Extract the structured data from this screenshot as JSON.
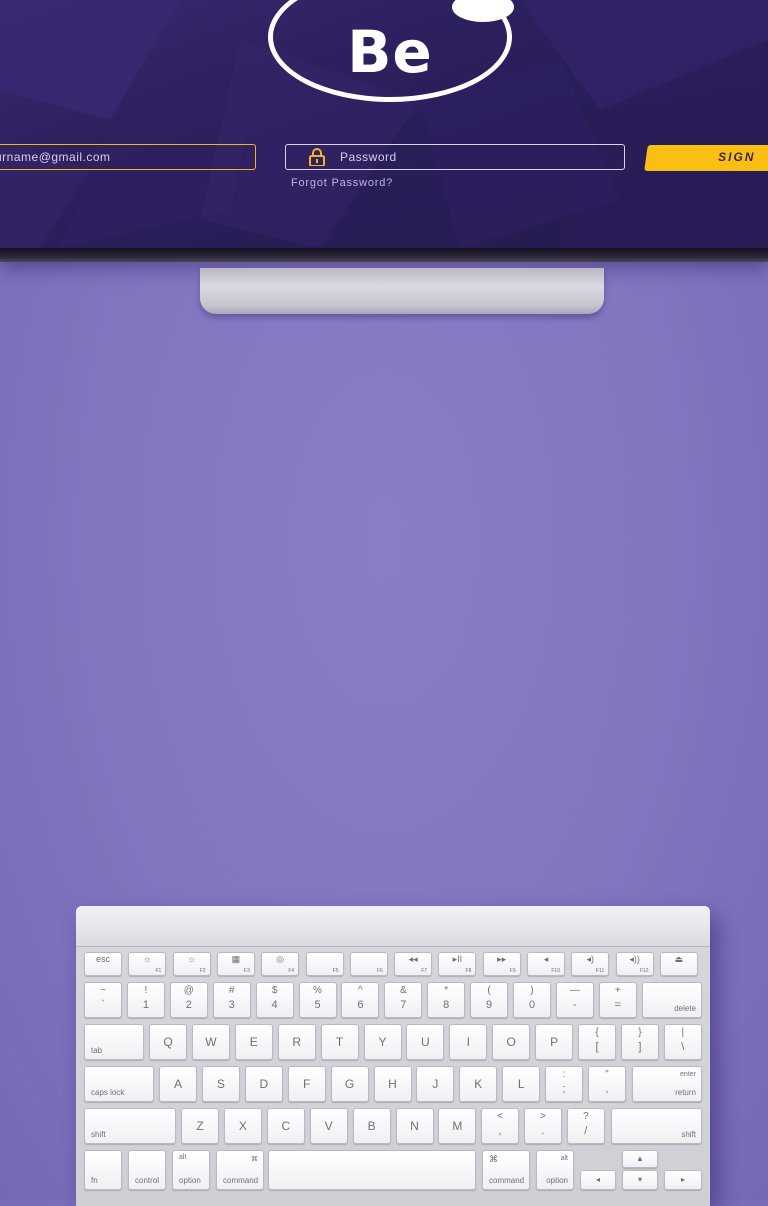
{
  "screen": {
    "logo_text": "Be",
    "email_value": "urname@gmail.com",
    "password_placeholder": "Password",
    "forgot_link": "Forgot Password?",
    "signin_label": "SIGN",
    "accent": "#fbbf14",
    "bg": "#2c1f5c"
  },
  "background_color": "#8579c3",
  "keyboard": {
    "fn_row": [
      {
        "sym": "esc",
        "fn": ""
      },
      {
        "sym": "☼",
        "fn": "F1"
      },
      {
        "sym": "☼",
        "fn": "F2"
      },
      {
        "sym": "▦",
        "fn": "F3"
      },
      {
        "sym": "◎",
        "fn": "F4"
      },
      {
        "sym": "",
        "fn": "F5"
      },
      {
        "sym": "",
        "fn": "F6"
      },
      {
        "sym": "◂◂",
        "fn": "F7"
      },
      {
        "sym": "▸II",
        "fn": "F8"
      },
      {
        "sym": "▸▸",
        "fn": "F9"
      },
      {
        "sym": "◂",
        "fn": "F10"
      },
      {
        "sym": "◂)",
        "fn": "F11"
      },
      {
        "sym": "◂))",
        "fn": "F12"
      },
      {
        "sym": "⏏",
        "fn": ""
      }
    ],
    "num_row": [
      {
        "t": "~",
        "b": "`"
      },
      {
        "t": "!",
        "b": "1"
      },
      {
        "t": "@",
        "b": "2"
      },
      {
        "t": "#",
        "b": "3"
      },
      {
        "t": "$",
        "b": "4"
      },
      {
        "t": "%",
        "b": "5"
      },
      {
        "t": "^",
        "b": "6"
      },
      {
        "t": "&",
        "b": "7"
      },
      {
        "t": "*",
        "b": "8"
      },
      {
        "t": "(",
        "b": "9"
      },
      {
        "t": ")",
        "b": "0"
      },
      {
        "t": "—",
        "b": "-"
      },
      {
        "t": "+",
        "b": "="
      }
    ],
    "delete_label": "delete",
    "tab_label": "tab",
    "qwerty_row": [
      "Q",
      "W",
      "E",
      "R",
      "T",
      "Y",
      "U",
      "I",
      "O",
      "P"
    ],
    "bracket_keys": [
      {
        "t": "{",
        "b": "["
      },
      {
        "t": "}",
        "b": "]"
      },
      {
        "t": "|",
        "b": "\\"
      }
    ],
    "caps_label": "caps lock",
    "home_row": [
      "A",
      "S",
      "D",
      "F",
      "G",
      "H",
      "J",
      "K",
      "L"
    ],
    "home_punct": [
      {
        "t": ":",
        "b": ";"
      },
      {
        "t": "\"",
        "b": ","
      }
    ],
    "enter_label": "enter",
    "return_label": "return",
    "shift_label": "shift",
    "bottom_row_letters": [
      "Z",
      "X",
      "C",
      "V",
      "B",
      "N",
      "M"
    ],
    "bottom_punct": [
      {
        "t": "<",
        "b": ","
      },
      {
        "t": ">",
        "b": "."
      },
      {
        "t": "?",
        "b": "/"
      }
    ],
    "fn_label": "fn",
    "control_label": "control",
    "alt_label": "alt",
    "option_label": "option",
    "command_symbol": "⌘",
    "command_label": "command",
    "arrow_up": "▲",
    "arrow_left": "◂",
    "arrow_down": "▾",
    "arrow_right": "▸"
  }
}
